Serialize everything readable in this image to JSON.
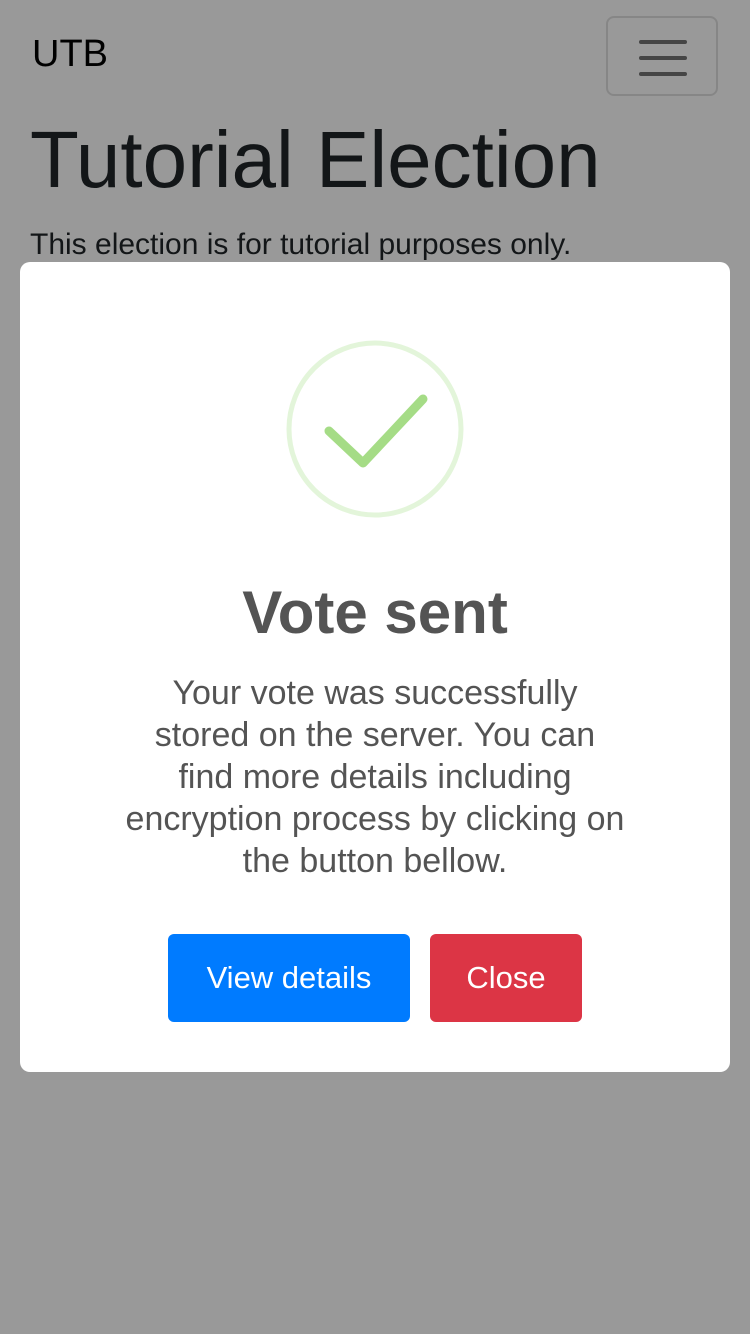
{
  "navbar": {
    "brand": "UTB",
    "toggler_icon": "hamburger-menu-icon"
  },
  "election": {
    "title": "Tutorial Election",
    "description": "This election is for tutorial purposes only."
  },
  "modal": {
    "icon": "success-check-icon",
    "title": "Vote sent",
    "text": "Your vote was successfully stored on the server. You can find more details including encryption process by clicking on the button bellow.",
    "confirm_label": "View details",
    "cancel_label": "Close"
  },
  "colors": {
    "overlay": "rgba(0,0,0,0.4)",
    "success_ring": "#e3f5da",
    "success_check": "#a5dc86",
    "primary": "#007bff",
    "danger": "#dc3545",
    "modal_text": "#545454"
  }
}
